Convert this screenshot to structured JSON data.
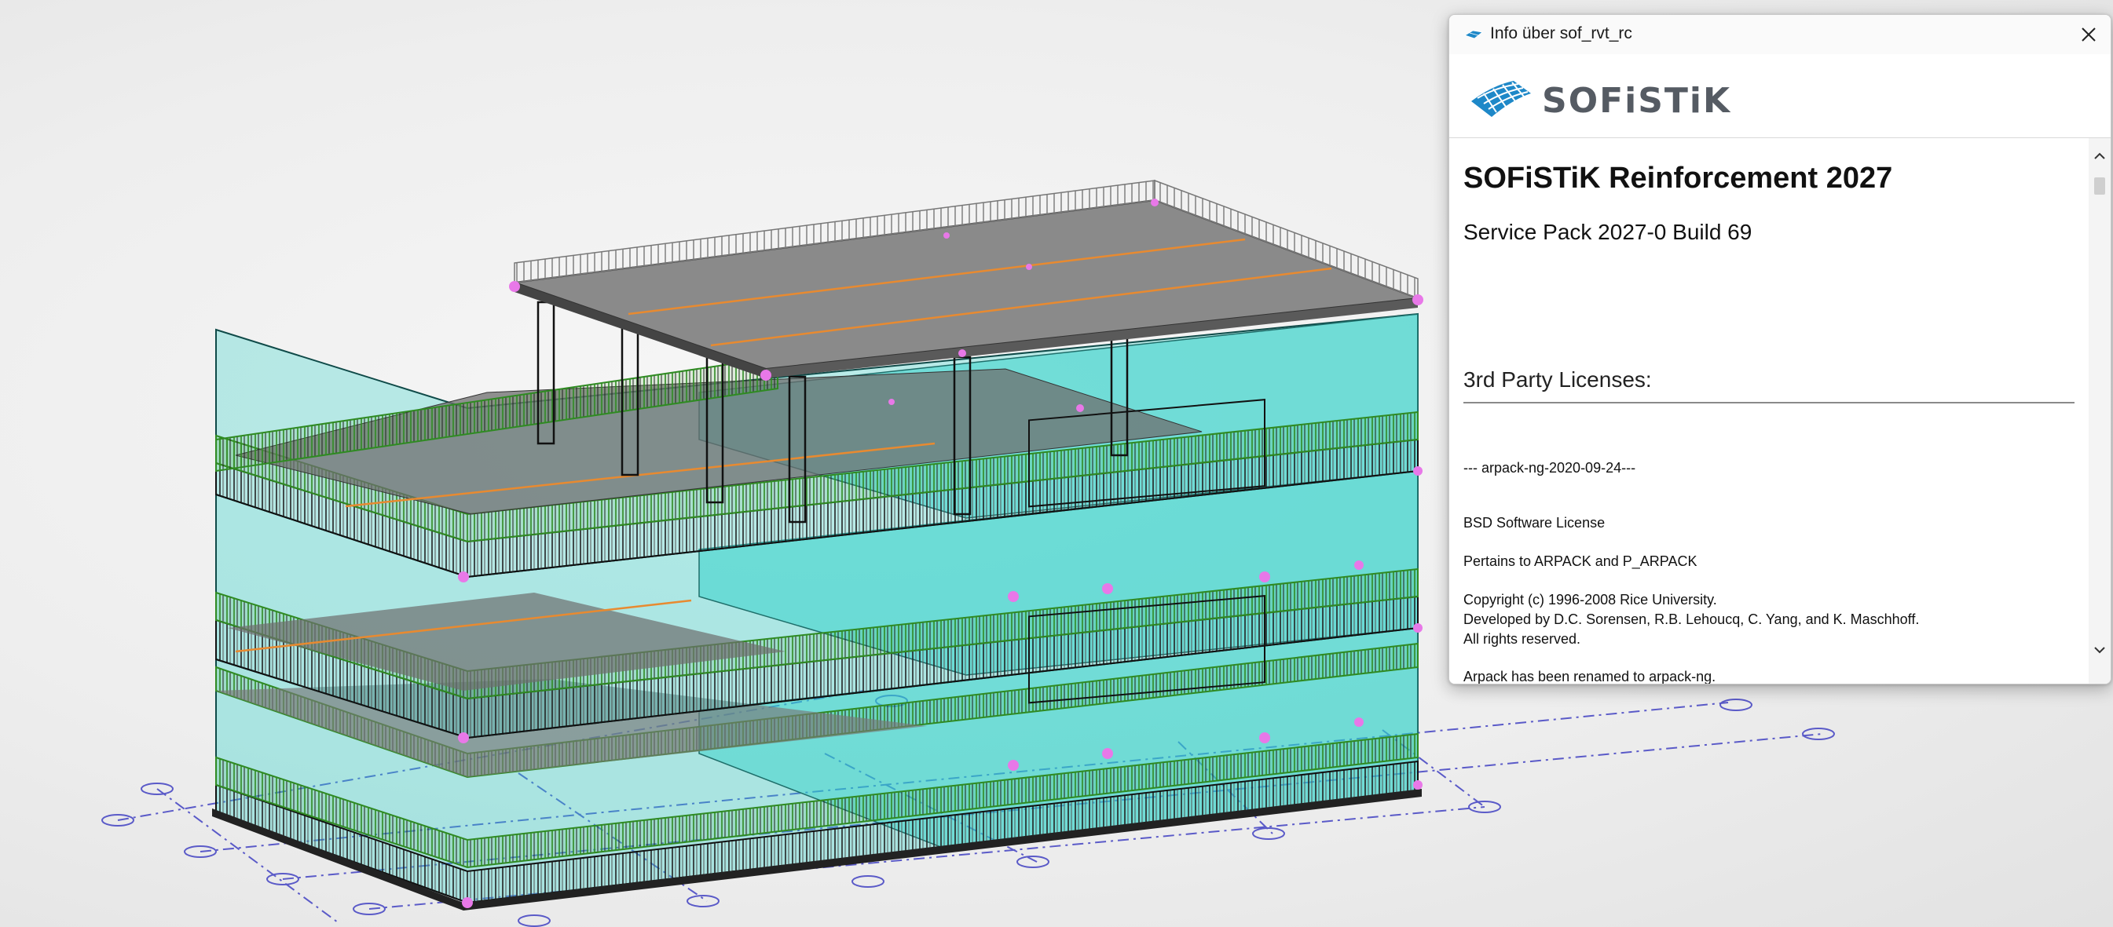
{
  "dialog": {
    "title": "Info über sof_rvt_rc",
    "close_icon": "close-icon",
    "logo_text": "SOFiSTiK",
    "product_title": "SOFiSTiK Reinforcement 2027",
    "service_pack": "Service Pack 2027-0 Build 69",
    "licenses_heading": "3rd Party Licenses:",
    "license_lines": [
      "--- arpack-ng-2020-09-24---",
      "BSD Software License",
      "Pertains to ARPACK and P_ARPACK",
      "Copyright (c) 1996-2008 Rice University.",
      "Developed by D.C. Sorensen, R.B. Lehoucq, C. Yang, and K. Maschhoff.",
      "All rights reserved.",
      "Arpack has been renamed to arpack-ng."
    ]
  },
  "colors": {
    "accent_blue": "#1e88c8",
    "slab_gray": "#7a7a7a",
    "wall_cyan": "#2ad0c8",
    "railing_green": "#3a9a2a",
    "rebar_orange": "#e88a30",
    "gridline_blue": "#5a5ac8",
    "node_pink": "#e878e8"
  }
}
